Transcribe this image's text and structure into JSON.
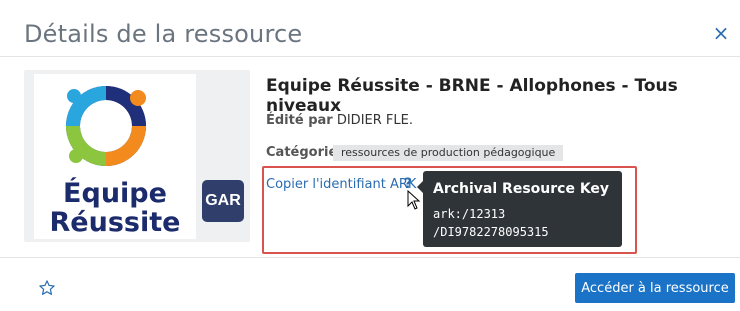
{
  "modal": {
    "title": "Détails de la ressource",
    "close_label": "×"
  },
  "resource": {
    "title": "Equipe Réussite - BRNE - Allophones - Tous niveaux",
    "edited_prefix": "Édité par",
    "editor": " DIDIER FLE.",
    "category_label": "Catégorie",
    "category_value": "ressources de production pédagogique",
    "thumbnail_logo_line1": "Équipe",
    "thumbnail_logo_line2": "Réussite",
    "gar_badge": "GAR"
  },
  "ark": {
    "link_label": "Copier l'identifiant ARK",
    "help_label": "?",
    "tooltip_title": "Archival Resource Key",
    "tooltip_line1": "ark:/12313",
    "tooltip_line2": "/DI9782278095315"
  },
  "footer": {
    "access_button": "Accéder à la ressource",
    "favorite_icon": "star-outline-icon"
  },
  "colors": {
    "accent": "#1a73c7",
    "link": "#2b6cb0",
    "highlight_border": "#d9534f",
    "tooltip_bg": "#2f3438"
  }
}
